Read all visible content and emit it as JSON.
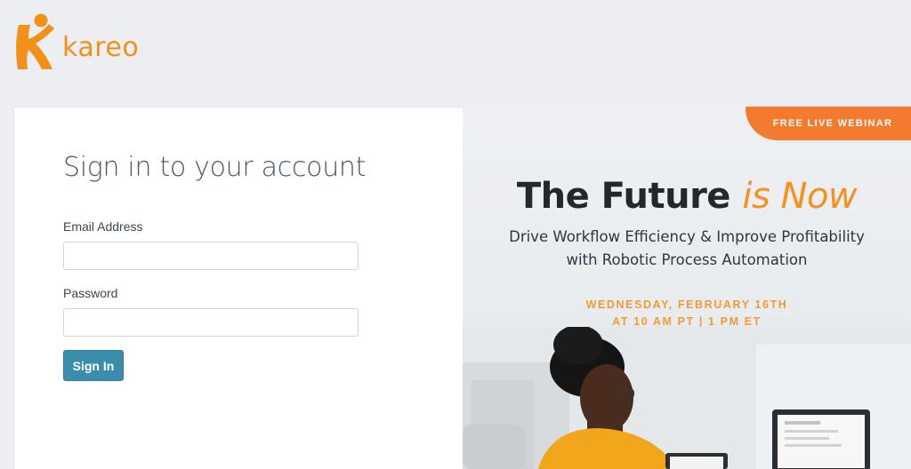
{
  "brand": {
    "name": "kareo",
    "color": "#f2901c"
  },
  "signin": {
    "title": "Sign in to your account",
    "email_label": "Email Address",
    "email_value": "",
    "password_label": "Password",
    "password_value": "",
    "button_label": "Sign In"
  },
  "promo": {
    "badge": "FREE LIVE WEBINAR",
    "headline_main": "The Future",
    "headline_accent": "is Now",
    "subtitle_line1": "Drive Workflow Efficiency & Improve Profitability",
    "subtitle_line2": "with  Robotic Process Automation",
    "date_line1": "WEDNESDAY, FEBRUARY 16TH",
    "date_line2": "AT 10 AM PT | 1 PM ET"
  },
  "colors": {
    "accent": "#f47a2f",
    "button": "#3b8eab",
    "background": "#eceef1"
  }
}
